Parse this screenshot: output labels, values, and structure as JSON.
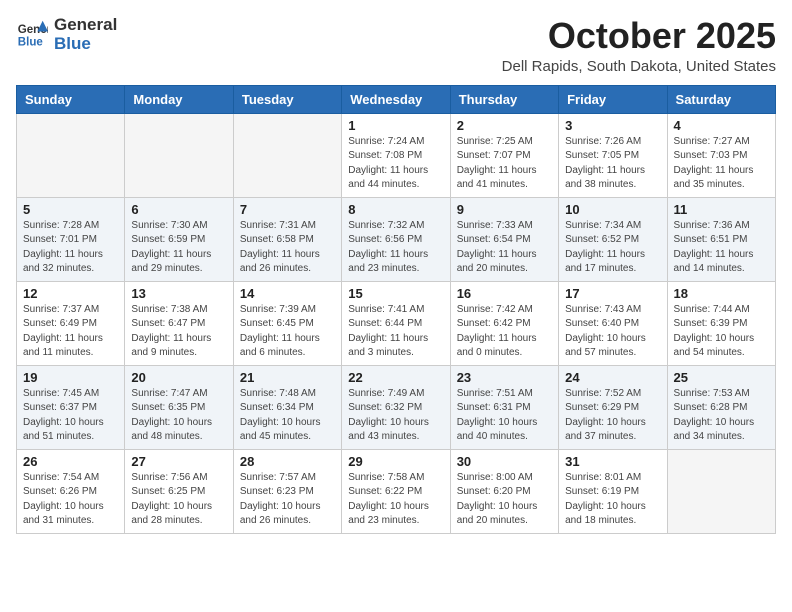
{
  "header": {
    "logo_general": "General",
    "logo_blue": "Blue",
    "month": "October 2025",
    "location": "Dell Rapids, South Dakota, United States"
  },
  "weekdays": [
    "Sunday",
    "Monday",
    "Tuesday",
    "Wednesday",
    "Thursday",
    "Friday",
    "Saturday"
  ],
  "weeks": [
    [
      {
        "day": "",
        "info": ""
      },
      {
        "day": "",
        "info": ""
      },
      {
        "day": "",
        "info": ""
      },
      {
        "day": "1",
        "info": "Sunrise: 7:24 AM\nSunset: 7:08 PM\nDaylight: 11 hours\nand 44 minutes."
      },
      {
        "day": "2",
        "info": "Sunrise: 7:25 AM\nSunset: 7:07 PM\nDaylight: 11 hours\nand 41 minutes."
      },
      {
        "day": "3",
        "info": "Sunrise: 7:26 AM\nSunset: 7:05 PM\nDaylight: 11 hours\nand 38 minutes."
      },
      {
        "day": "4",
        "info": "Sunrise: 7:27 AM\nSunset: 7:03 PM\nDaylight: 11 hours\nand 35 minutes."
      }
    ],
    [
      {
        "day": "5",
        "info": "Sunrise: 7:28 AM\nSunset: 7:01 PM\nDaylight: 11 hours\nand 32 minutes."
      },
      {
        "day": "6",
        "info": "Sunrise: 7:30 AM\nSunset: 6:59 PM\nDaylight: 11 hours\nand 29 minutes."
      },
      {
        "day": "7",
        "info": "Sunrise: 7:31 AM\nSunset: 6:58 PM\nDaylight: 11 hours\nand 26 minutes."
      },
      {
        "day": "8",
        "info": "Sunrise: 7:32 AM\nSunset: 6:56 PM\nDaylight: 11 hours\nand 23 minutes."
      },
      {
        "day": "9",
        "info": "Sunrise: 7:33 AM\nSunset: 6:54 PM\nDaylight: 11 hours\nand 20 minutes."
      },
      {
        "day": "10",
        "info": "Sunrise: 7:34 AM\nSunset: 6:52 PM\nDaylight: 11 hours\nand 17 minutes."
      },
      {
        "day": "11",
        "info": "Sunrise: 7:36 AM\nSunset: 6:51 PM\nDaylight: 11 hours\nand 14 minutes."
      }
    ],
    [
      {
        "day": "12",
        "info": "Sunrise: 7:37 AM\nSunset: 6:49 PM\nDaylight: 11 hours\nand 11 minutes."
      },
      {
        "day": "13",
        "info": "Sunrise: 7:38 AM\nSunset: 6:47 PM\nDaylight: 11 hours\nand 9 minutes."
      },
      {
        "day": "14",
        "info": "Sunrise: 7:39 AM\nSunset: 6:45 PM\nDaylight: 11 hours\nand 6 minutes."
      },
      {
        "day": "15",
        "info": "Sunrise: 7:41 AM\nSunset: 6:44 PM\nDaylight: 11 hours\nand 3 minutes."
      },
      {
        "day": "16",
        "info": "Sunrise: 7:42 AM\nSunset: 6:42 PM\nDaylight: 11 hours\nand 0 minutes."
      },
      {
        "day": "17",
        "info": "Sunrise: 7:43 AM\nSunset: 6:40 PM\nDaylight: 10 hours\nand 57 minutes."
      },
      {
        "day": "18",
        "info": "Sunrise: 7:44 AM\nSunset: 6:39 PM\nDaylight: 10 hours\nand 54 minutes."
      }
    ],
    [
      {
        "day": "19",
        "info": "Sunrise: 7:45 AM\nSunset: 6:37 PM\nDaylight: 10 hours\nand 51 minutes."
      },
      {
        "day": "20",
        "info": "Sunrise: 7:47 AM\nSunset: 6:35 PM\nDaylight: 10 hours\nand 48 minutes."
      },
      {
        "day": "21",
        "info": "Sunrise: 7:48 AM\nSunset: 6:34 PM\nDaylight: 10 hours\nand 45 minutes."
      },
      {
        "day": "22",
        "info": "Sunrise: 7:49 AM\nSunset: 6:32 PM\nDaylight: 10 hours\nand 43 minutes."
      },
      {
        "day": "23",
        "info": "Sunrise: 7:51 AM\nSunset: 6:31 PM\nDaylight: 10 hours\nand 40 minutes."
      },
      {
        "day": "24",
        "info": "Sunrise: 7:52 AM\nSunset: 6:29 PM\nDaylight: 10 hours\nand 37 minutes."
      },
      {
        "day": "25",
        "info": "Sunrise: 7:53 AM\nSunset: 6:28 PM\nDaylight: 10 hours\nand 34 minutes."
      }
    ],
    [
      {
        "day": "26",
        "info": "Sunrise: 7:54 AM\nSunset: 6:26 PM\nDaylight: 10 hours\nand 31 minutes."
      },
      {
        "day": "27",
        "info": "Sunrise: 7:56 AM\nSunset: 6:25 PM\nDaylight: 10 hours\nand 28 minutes."
      },
      {
        "day": "28",
        "info": "Sunrise: 7:57 AM\nSunset: 6:23 PM\nDaylight: 10 hours\nand 26 minutes."
      },
      {
        "day": "29",
        "info": "Sunrise: 7:58 AM\nSunset: 6:22 PM\nDaylight: 10 hours\nand 23 minutes."
      },
      {
        "day": "30",
        "info": "Sunrise: 8:00 AM\nSunset: 6:20 PM\nDaylight: 10 hours\nand 20 minutes."
      },
      {
        "day": "31",
        "info": "Sunrise: 8:01 AM\nSunset: 6:19 PM\nDaylight: 10 hours\nand 18 minutes."
      },
      {
        "day": "",
        "info": ""
      }
    ]
  ]
}
